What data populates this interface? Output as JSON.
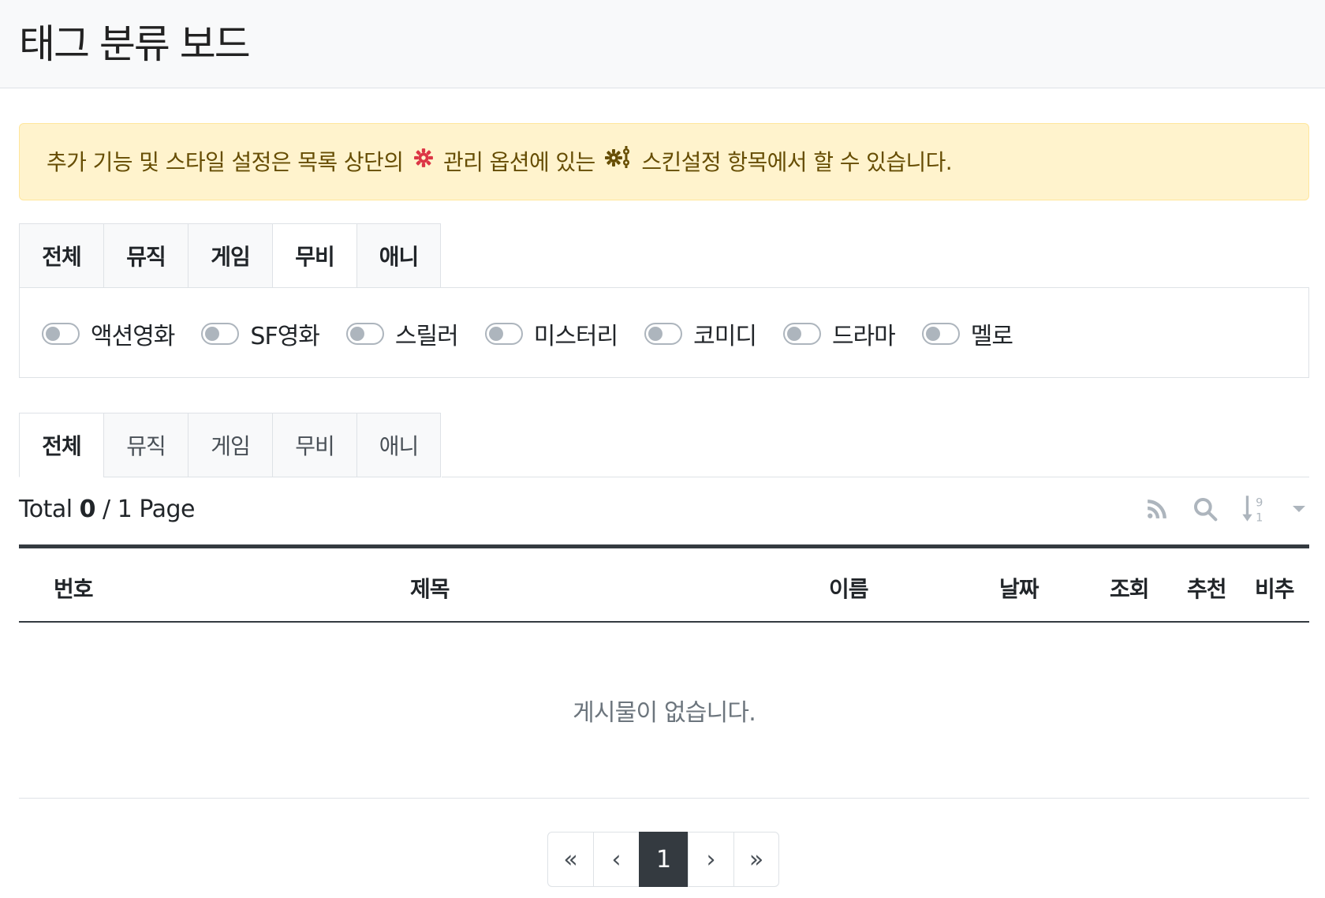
{
  "header": {
    "title": "태그 분류 보드"
  },
  "alert": {
    "text_before": "추가 기능 및 스타일 설정은 목록 상단의",
    "icon1": "gear-icon",
    "text_middle": "관리 옵션에 있는",
    "icon2": "gears-icon",
    "text_after": "스킨설정 항목에서 할 수 있습니다."
  },
  "category_tabs": {
    "items": [
      "전체",
      "뮤직",
      "게임",
      "무비",
      "애니"
    ],
    "active": "무비"
  },
  "tag_toggles": [
    "액션영화",
    "SF영화",
    "스릴러",
    "미스터리",
    "코미디",
    "드라마",
    "멜로"
  ],
  "list_tabs": {
    "items": [
      "전체",
      "뮤직",
      "게임",
      "무비",
      "애니"
    ],
    "active": "전체"
  },
  "summary": {
    "total_label": "Total",
    "total": "0",
    "sep": "/",
    "pages": "1",
    "page_label": "Page"
  },
  "toolbar": {
    "rss": "rss-icon",
    "search": "search-icon",
    "sort": "sort-numeric-icon",
    "dropdown": "caret-down-icon"
  },
  "table": {
    "columns": [
      "번호",
      "제목",
      "이름",
      "날짜",
      "조회",
      "추천",
      "비추"
    ],
    "empty_message": "게시물이 없습니다."
  },
  "pagination": {
    "first": "«",
    "prev": "‹",
    "current": "1",
    "next": "›",
    "last": "»"
  },
  "colors": {
    "active_page": "#343a40",
    "alert_bg": "#fff3cd",
    "alert_text": "#664d03",
    "gear_red": "#dc3545"
  }
}
